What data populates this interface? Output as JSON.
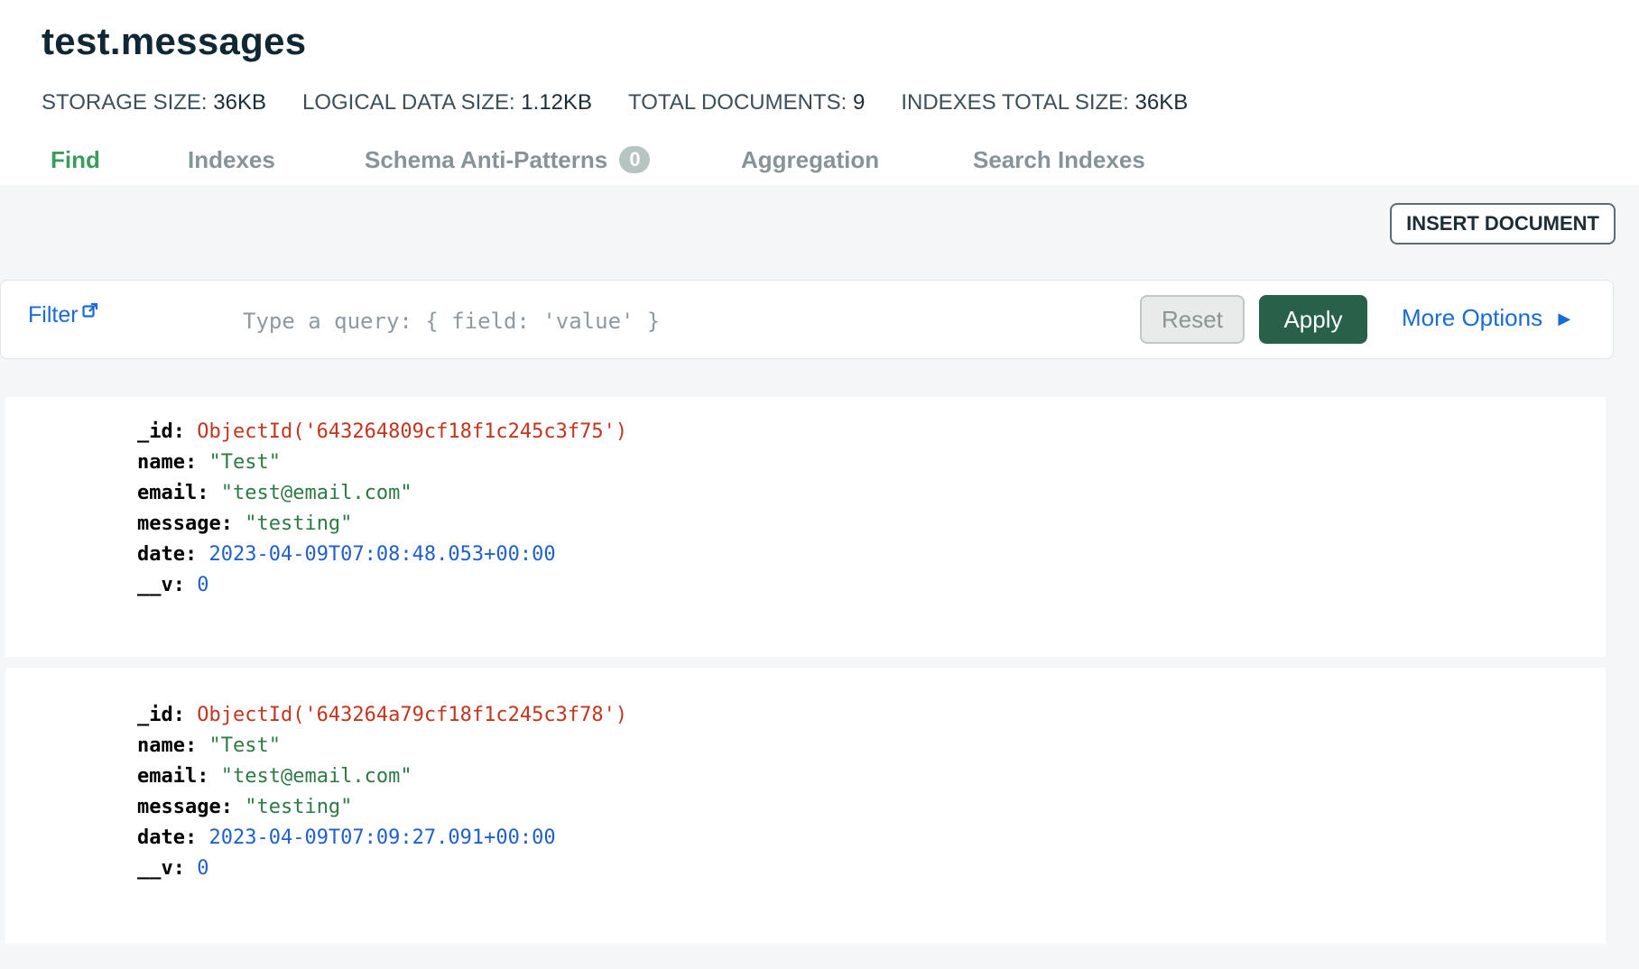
{
  "collection": {
    "title": "test.messages"
  },
  "stats": [
    {
      "label": "STORAGE SIZE:",
      "value": "36KB"
    },
    {
      "label": "LOGICAL DATA SIZE:",
      "value": "1.12KB"
    },
    {
      "label": "TOTAL DOCUMENTS:",
      "value": "9"
    },
    {
      "label": "INDEXES TOTAL SIZE:",
      "value": "36KB"
    }
  ],
  "tabs": [
    {
      "label": "Find",
      "active": true
    },
    {
      "label": "Indexes"
    },
    {
      "label": "Schema Anti-Patterns",
      "badge": "0"
    },
    {
      "label": "Aggregation"
    },
    {
      "label": "Search Indexes"
    }
  ],
  "toolbar": {
    "insert_label": "INSERT DOCUMENT"
  },
  "filter": {
    "label": "Filter",
    "placeholder": "Type a query: { field: 'value' }",
    "reset_label": "Reset",
    "apply_label": "Apply",
    "more_options_label": "More Options"
  },
  "documents": [
    {
      "id_key": "_id:",
      "id_value": "ObjectId('643264809cf18f1c245c3f75')",
      "name_key": "name:",
      "name_value": "\"Test\"",
      "email_key": "email:",
      "email_value": "\"test@email.com\"",
      "message_key": "message:",
      "message_value": "\"testing\"",
      "date_key": "date:",
      "date_value": "2023-04-09T07:08:48.053+00:00",
      "v_key": "__v:",
      "v_value": "0"
    },
    {
      "id_key": "_id:",
      "id_value": "ObjectId('643264a79cf18f1c245c3f78')",
      "name_key": "name:",
      "name_value": "\"Test\"",
      "email_key": "email:",
      "email_value": "\"test@email.com\"",
      "message_key": "message:",
      "message_value": "\"testing\"",
      "date_key": "date:",
      "date_value": "2023-04-09T07:09:27.091+00:00",
      "v_key": "__v:",
      "v_value": "0"
    }
  ],
  "colors": {
    "active_tab": "#3a9d5d",
    "apply_button": "#29604a",
    "link": "#1a6bd6",
    "objectid": "#c2351f",
    "string": "#2d7a44",
    "number": "#1f5fcf"
  },
  "icons": {
    "filter_link": "external-link-icon",
    "more_options": "caret-right-icon"
  }
}
